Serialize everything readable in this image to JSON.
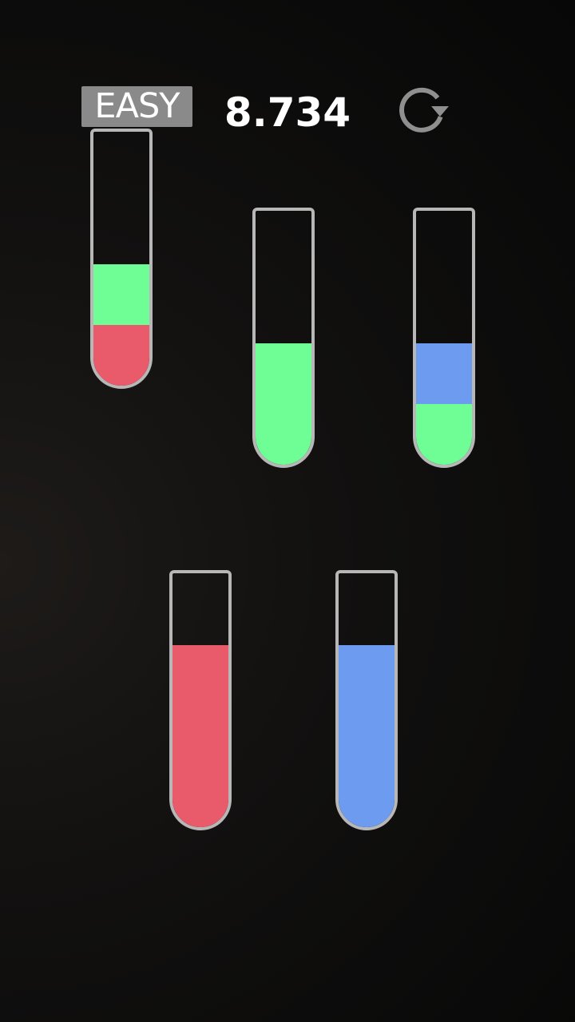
{
  "header": {
    "difficulty": "EASY",
    "timer": "8.734",
    "restart_icon": "restart-icon"
  },
  "tube_capacity": 4,
  "colors": {
    "red": "#e95b6b",
    "green": "#6ffe96",
    "blue": "#6d9bef",
    "glass": "#b7b7b7"
  },
  "tubes": [
    {
      "id": "tube-1",
      "layers": [
        "red",
        "green"
      ]
    },
    {
      "id": "tube-2",
      "layers": [
        "green",
        "green"
      ]
    },
    {
      "id": "tube-3",
      "layers": [
        "green",
        "blue"
      ]
    },
    {
      "id": "tube-4",
      "layers": [
        "red",
        "red",
        "red"
      ]
    },
    {
      "id": "tube-5",
      "layers": [
        "blue",
        "blue",
        "blue"
      ]
    }
  ]
}
